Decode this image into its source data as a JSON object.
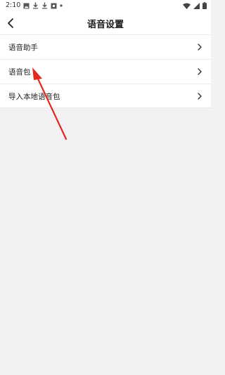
{
  "status_bar": {
    "time": "2:10",
    "icons_left": [
      "image-icon",
      "download-icon",
      "download-icon",
      "app-icon",
      "dot-icon"
    ],
    "icons_right": [
      "wifi-icon",
      "signal-icon",
      "battery-icon"
    ]
  },
  "header": {
    "title": "语音设置",
    "back_icon": "back-arrow-icon"
  },
  "settings": {
    "items": [
      {
        "label": "语音助手"
      },
      {
        "label": "语音包"
      },
      {
        "label": "导入本地语音包"
      }
    ]
  },
  "colors": {
    "background": "#f2f2f4",
    "surface": "#ffffff",
    "annotation": "#e02a1e"
  }
}
